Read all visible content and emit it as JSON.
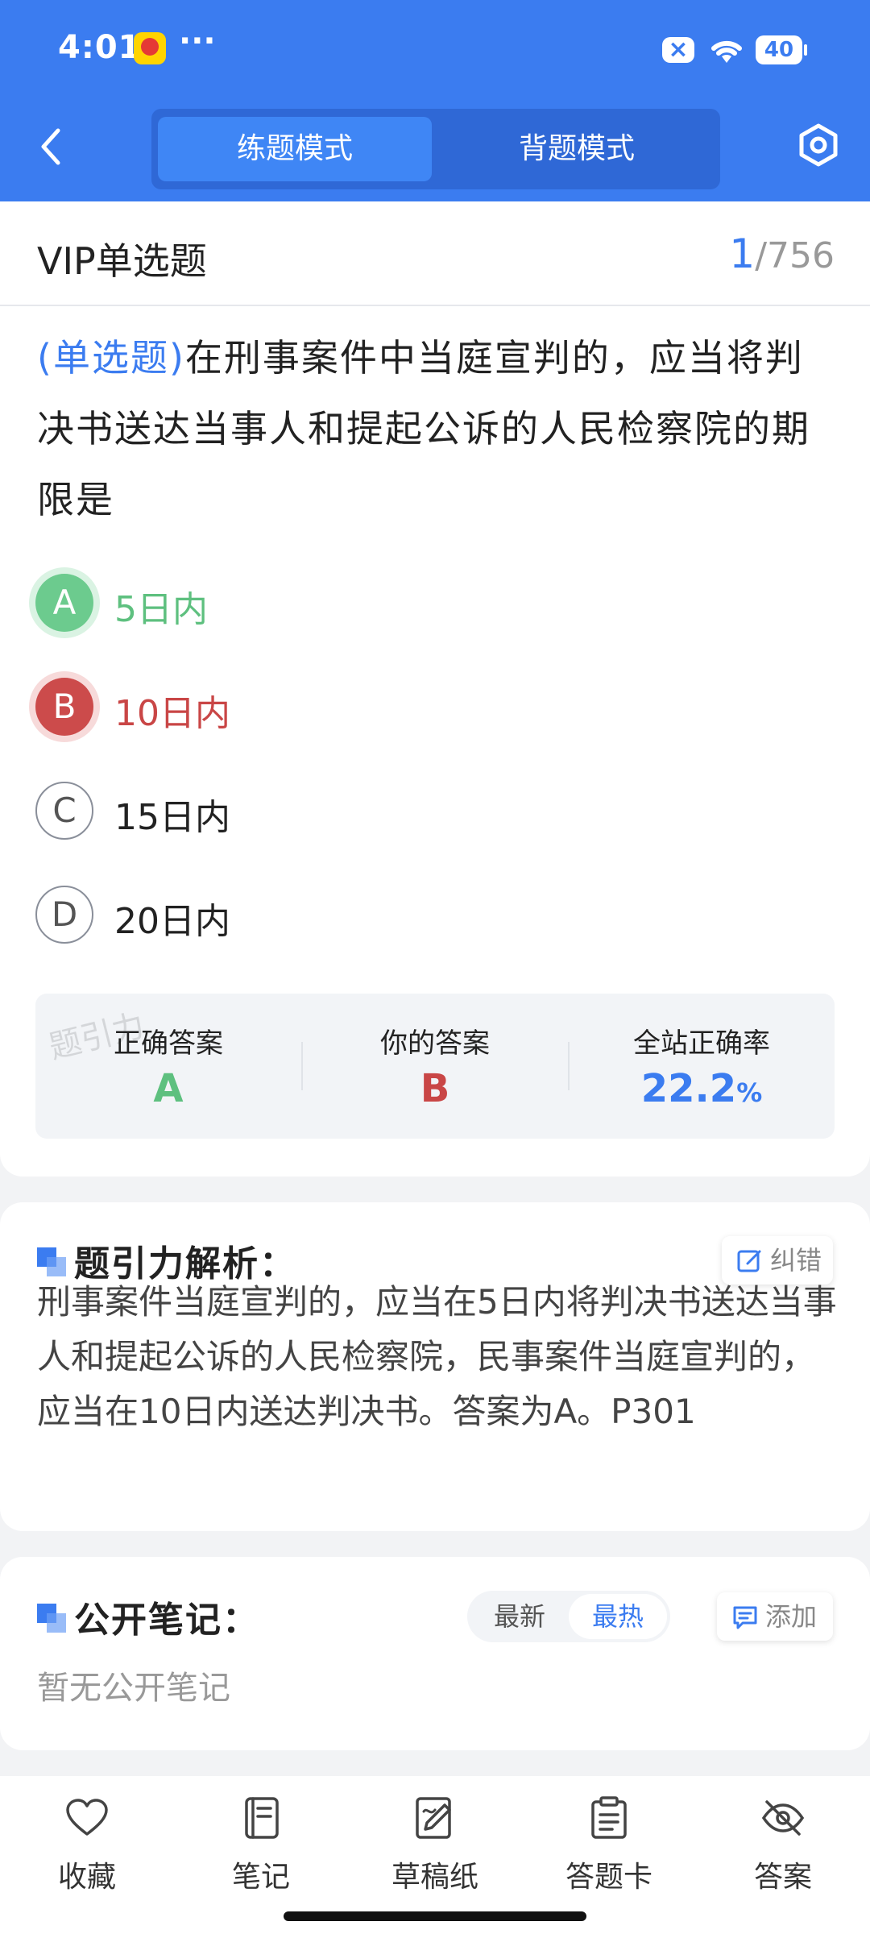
{
  "status_bar": {
    "time": "4:01",
    "more": "···",
    "battery": "40"
  },
  "header": {
    "tabs": [
      {
        "label": "练题模式",
        "active": true
      },
      {
        "label": "背题模式",
        "active": false
      }
    ],
    "icons": {
      "back": "chevron-left-icon",
      "settings": "hexagon-settings-icon"
    }
  },
  "question": {
    "type_title": "VIP单选题",
    "current": "1",
    "total": "/756",
    "tag": "(单选题)",
    "text": "在刑事案件中当庭宣判的，应当将判决书送达当事人和提起公诉的人民检察院的期限是",
    "options": [
      {
        "letter": "A",
        "text": "5日内",
        "state": "correct"
      },
      {
        "letter": "B",
        "text": "10日内",
        "state": "wrong"
      },
      {
        "letter": "C",
        "text": "15日内",
        "state": "normal"
      },
      {
        "letter": "D",
        "text": "20日内",
        "state": "normal"
      }
    ]
  },
  "answer_summary": {
    "correct_label": "正确答案",
    "correct_value": "A",
    "yours_label": "你的答案",
    "yours_value": "B",
    "rate_label": "全站正确率",
    "rate_value": "22.2",
    "rate_unit": "%",
    "watermark": "题引力"
  },
  "analysis": {
    "title": "题引力解析：",
    "correction_button": "纠错",
    "text": "刑事案件当庭宣判的，应当在5日内将判决书送达当事人和提起公诉的人民检察院，民事案件当庭宣判的，应当在10日内送达判决书。答案为A。P301"
  },
  "notes": {
    "title": "公开笔记：",
    "sort_latest": "最新",
    "sort_hot": "最热",
    "sort_selected": "最热",
    "add_button": "添加",
    "empty_text": "暂无公开笔记"
  },
  "bottom_nav": [
    {
      "label": "收藏",
      "icon": "heart-icon"
    },
    {
      "label": "笔记",
      "icon": "notebook-icon"
    },
    {
      "label": "草稿纸",
      "icon": "draft-paper-icon"
    },
    {
      "label": "答题卡",
      "icon": "answer-card-icon"
    },
    {
      "label": "答案",
      "icon": "eye-off-icon"
    }
  ],
  "colors": {
    "primary": "#3b7cf0",
    "correct": "#5ec07f",
    "wrong": "#c94646"
  }
}
